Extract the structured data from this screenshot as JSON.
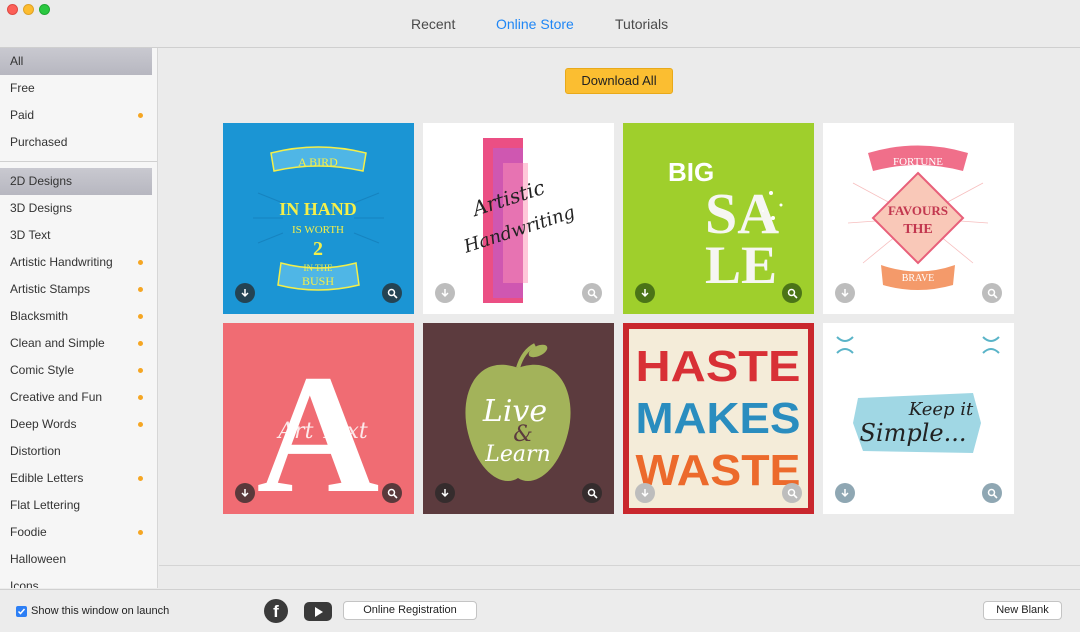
{
  "tabs": [
    {
      "label": "Recent",
      "active": false
    },
    {
      "label": "Online Store",
      "active": true
    },
    {
      "label": "Tutorials",
      "active": false
    }
  ],
  "sidebar": {
    "filters": [
      {
        "label": "All",
        "selected": true,
        "dot": false
      },
      {
        "label": "Free",
        "selected": false,
        "dot": false
      },
      {
        "label": "Paid",
        "selected": false,
        "dot": true
      },
      {
        "label": "Purchased",
        "selected": false,
        "dot": false
      }
    ],
    "categories": [
      {
        "label": "2D Designs",
        "selected": true,
        "dot": false
      },
      {
        "label": "3D Designs",
        "selected": false,
        "dot": false
      },
      {
        "label": "3D Text",
        "selected": false,
        "dot": false
      },
      {
        "label": "Artistic Handwriting",
        "selected": false,
        "dot": true
      },
      {
        "label": "Artistic Stamps",
        "selected": false,
        "dot": true
      },
      {
        "label": "Blacksmith",
        "selected": false,
        "dot": true
      },
      {
        "label": "Clean and Simple",
        "selected": false,
        "dot": true
      },
      {
        "label": "Comic Style",
        "selected": false,
        "dot": true
      },
      {
        "label": "Creative and Fun",
        "selected": false,
        "dot": true
      },
      {
        "label": "Deep Words",
        "selected": false,
        "dot": true
      },
      {
        "label": "Distortion",
        "selected": false,
        "dot": false
      },
      {
        "label": "Edible Letters",
        "selected": false,
        "dot": true
      },
      {
        "label": "Flat Lettering",
        "selected": false,
        "dot": false
      },
      {
        "label": "Foodie",
        "selected": false,
        "dot": true
      },
      {
        "label": "Halloween",
        "selected": false,
        "dot": false
      },
      {
        "label": "Icons",
        "selected": false,
        "dot": false
      }
    ]
  },
  "main": {
    "download_all_label": "Download All",
    "tiles": [
      {
        "name": "a-bird-in-hand",
        "bg": "#1b95d4",
        "text": [
          "A BIRD",
          "IN HAND",
          "IS WORTH",
          "2",
          "IN THE",
          "BUSH"
        ]
      },
      {
        "name": "handwriting-script",
        "bg": "#ffffff",
        "text": [
          "Artistic",
          "Handwriting"
        ]
      },
      {
        "name": "big-sale",
        "bg": "#9fcf2c",
        "text": [
          "BIG",
          "SA",
          "LE"
        ]
      },
      {
        "name": "fortune-favours-the-brave",
        "bg": "#ffffff",
        "text": [
          "FORTUNE",
          "FAVOURS",
          "THE",
          "BRAVE"
        ]
      },
      {
        "name": "letter-a",
        "bg": "#ef5f78",
        "text": [
          "A",
          "Art Text"
        ]
      },
      {
        "name": "apple-live-learn",
        "bg": "#5c3b3e",
        "text": [
          "Live",
          "&",
          "Learn"
        ]
      },
      {
        "name": "haste-makes-waste",
        "bg": "#f4ecd9",
        "text": [
          "HASTE",
          "MAKES",
          "WASTE"
        ]
      },
      {
        "name": "keep-it-simple",
        "bg": "#ffffff",
        "text": [
          "Keep it",
          "Simple..."
        ]
      }
    ]
  },
  "footer": {
    "show_on_launch_label": "Show this window on launch",
    "show_on_launch_checked": true,
    "facebook_icon": "facebook-icon",
    "youtube_icon": "youtube-icon",
    "registration_label": "Online Registration",
    "new_blank_label": "New Blank"
  }
}
